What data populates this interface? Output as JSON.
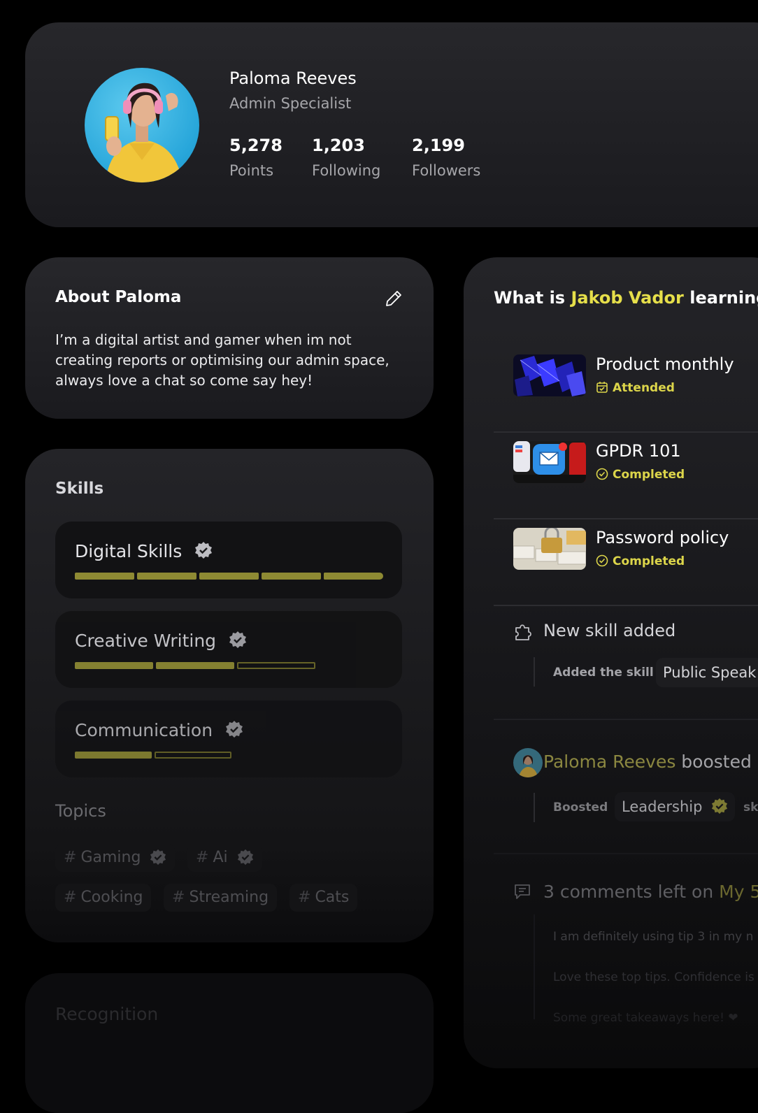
{
  "profile": {
    "name": "Paloma Reeves",
    "role": "Admin Specialist",
    "stats": [
      {
        "value": "5,278",
        "label": "Points"
      },
      {
        "value": "1,203",
        "label": "Following"
      },
      {
        "value": "2,199",
        "label": "Followers"
      }
    ]
  },
  "about": {
    "title": "About Paloma",
    "text": "I’m a digital artist and gamer when im not creating reports or optimising our admin space, always love a chat so come say hey!"
  },
  "skills": {
    "title": "Skills",
    "items": [
      {
        "name": "Digital Skills",
        "level": 5,
        "max": 5
      },
      {
        "name": "Creative Writing",
        "level": 2,
        "max": 3
      },
      {
        "name": "Communication",
        "level": 1,
        "max": 2
      }
    ],
    "topics_title": "Topics",
    "topics": [
      {
        "name": "Gaming",
        "verified": true
      },
      {
        "name": "Ai",
        "verified": true
      },
      {
        "name": "Cooking",
        "verified": false
      },
      {
        "name": "Streaming",
        "verified": false
      },
      {
        "name": "Cats",
        "verified": false
      }
    ],
    "hash_symbol": "#"
  },
  "recognition": {
    "title": "Recognition"
  },
  "learning": {
    "title_prefix": "What is ",
    "person": "Jakob Vador",
    "title_suffix": " learning?",
    "courses": [
      {
        "name": "Product monthly",
        "status": "Attended",
        "icon": "calendar-check-icon"
      },
      {
        "name": "GPDR 101",
        "status": "Completed",
        "icon": "check-circle-icon"
      },
      {
        "name": "Password policy",
        "status": "Completed",
        "icon": "check-circle-icon"
      }
    ],
    "new_skill": {
      "title": "New skill added",
      "label": "Added the skill",
      "skill": "Public Speak"
    },
    "boost": {
      "actor": "Paloma Reeves",
      "action": " boosted",
      "label": "Boosted",
      "skill": "Leadership",
      "trailing": "sk"
    },
    "comments": {
      "count_text": "3 comments left on",
      "target": " My 5",
      "items": [
        "I am definitely using tip 3 in my n",
        "Love these top tips. Confidence is",
        "Some great takeaways here! ❤"
      ]
    }
  },
  "colors": {
    "accent": "#e6df4a",
    "bar": "#8e8a33",
    "background": "#000000"
  }
}
